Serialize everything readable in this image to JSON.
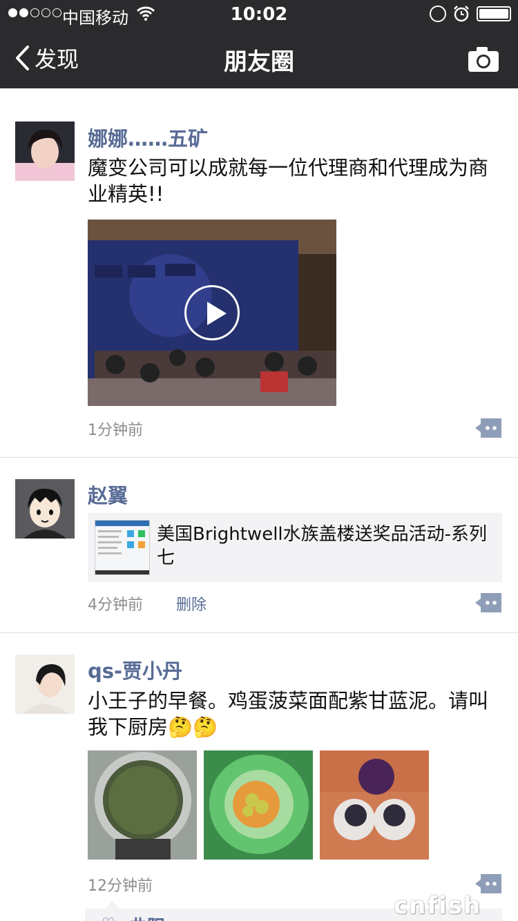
{
  "status_bar": {
    "carrier": "中国移动",
    "time": "10:02",
    "signal_filled": 2,
    "signal_total": 5,
    "battery_level": 1.0
  },
  "nav": {
    "back_label": "发现",
    "title": "朋友圈",
    "back_icon": "chevron-left-icon",
    "camera_icon": "camera-icon"
  },
  "posts": [
    {
      "name": "娜娜……五矿",
      "text": "魔变公司可以成就每一位代理商和代理成为商业精英!!",
      "time": "1分钟前"
    },
    {
      "name": "赵翼",
      "share_title": "美国Brightwell水族盖楼送奖品活动-系列七",
      "time": "4分钟前",
      "delete_label": "删除"
    },
    {
      "name": "qs-贾小丹",
      "text": "小王子的早餐。鸡蛋菠菜面配紫甘蓝泥。请叫我下厨房🤔🤔",
      "time": "12分钟前",
      "likes": [
        "曲阳"
      ]
    }
  ],
  "watermark": "cnfish",
  "colors": {
    "nav_bg": "#2b2b2e",
    "name_link": "#576b95",
    "time_gray": "#8c8c8c",
    "share_bg": "#f3f3f5"
  }
}
